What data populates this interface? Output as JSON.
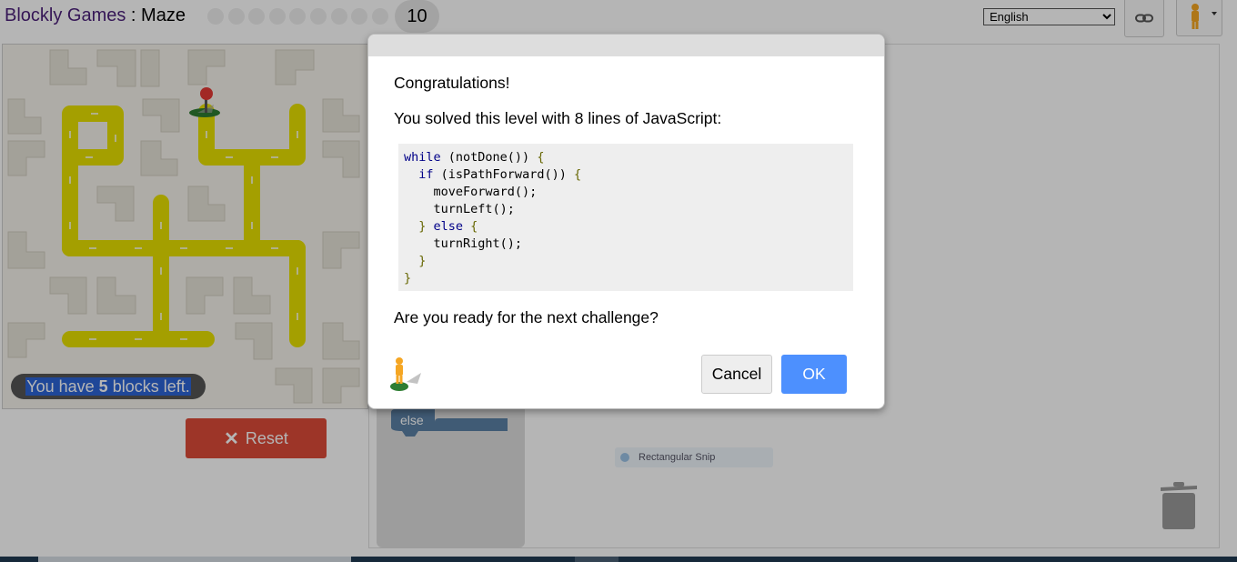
{
  "header": {
    "app_name": "Blockly Games",
    "separator": " : ",
    "game_name": "Maze",
    "level_dots_count": 9,
    "current_level": "10",
    "language": "English",
    "language_options": [
      "English"
    ]
  },
  "maze": {
    "blocks_left_prefix": "You have ",
    "blocks_left_count": "5",
    "blocks_left_suffix": " blocks left.",
    "reset_label": "Reset"
  },
  "workspace": {
    "flyout_block_label": "else",
    "snip_label": "Rectangular Snip"
  },
  "dialog": {
    "congrats": "Congratulations!",
    "solved_text": "You solved this level with 8 lines of JavaScript:",
    "code": {
      "l1_kw": "while",
      "l1_rest": " (notDone())",
      "l1_brace": " {",
      "l2_kw": "if",
      "l2_rest": " (isPathForward())",
      "l2_brace": " {",
      "l3": "moveForward();",
      "l4": "turnLeft();",
      "l5_close": "}",
      "l5_kw": " else",
      "l5_brace": " {",
      "l6": "turnRight();",
      "l7": "}",
      "l8": "}"
    },
    "ready_text": "Are you ready for the next challenge?",
    "cancel_label": "Cancel",
    "ok_label": "OK"
  },
  "colors": {
    "path_yellow": "#e8e000",
    "reset_red": "#dd4b39",
    "ok_blue": "#4d90fe",
    "block_blue": "#5b80a5",
    "title_purple": "#4b1f7a"
  }
}
